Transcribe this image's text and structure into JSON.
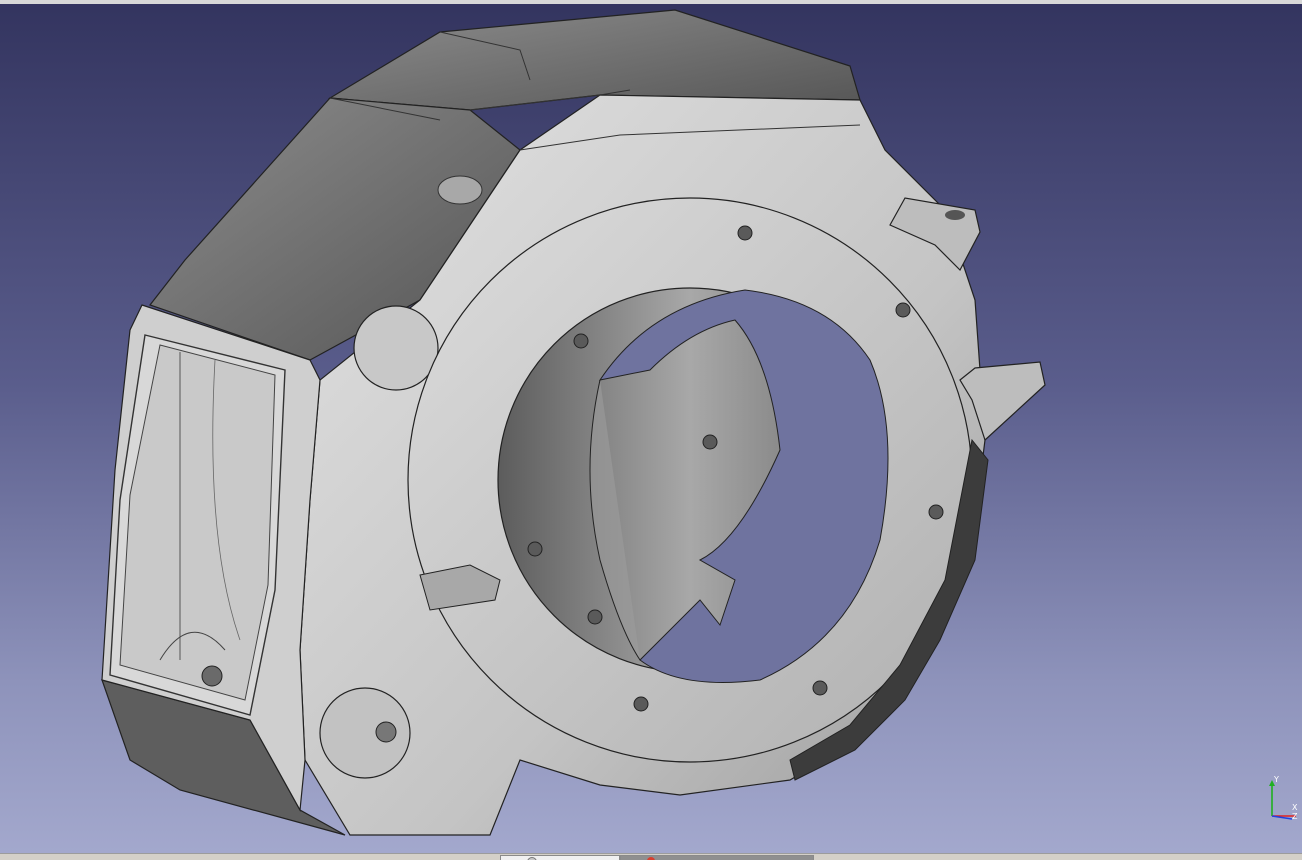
{
  "window": {
    "background_top_color": "#33345f",
    "background_bottom_color": "#a3a8cd",
    "model_color": "#b9b9b9"
  },
  "axis_indicator": {
    "x_label": "X",
    "y_label": "Y",
    "z_label": "Z",
    "x_color": "#e02020",
    "y_color": "#20b020",
    "z_color": "#2040e0"
  },
  "tabs": [
    {
      "icon": "document-icon",
      "active": true
    },
    {
      "icon": "part-icon",
      "active": false
    }
  ]
}
